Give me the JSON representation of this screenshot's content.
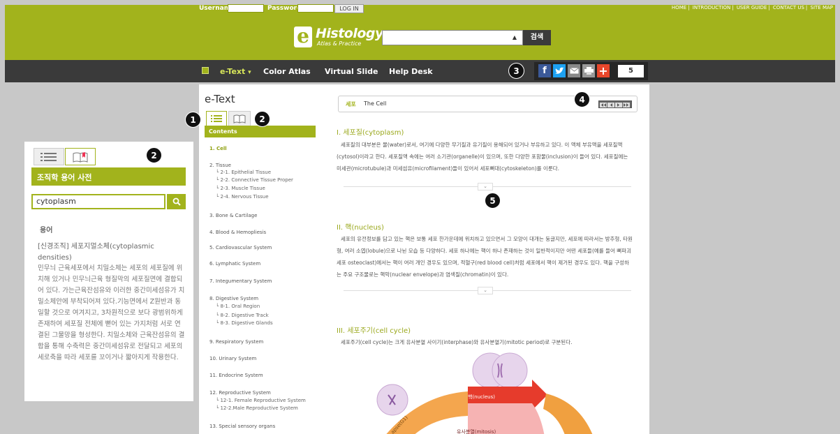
{
  "login": {
    "username_label": "Username",
    "password_label": "Password",
    "login_button": "LOG IN"
  },
  "toplinks": [
    "HOME",
    "INTRODUCTION",
    "USER GUIDE",
    "CONTACT US",
    "SITE MAP"
  ],
  "logo": {
    "mark": "e",
    "title": "Histology",
    "subtitle": "Atlas & Practice"
  },
  "search": {
    "button": "검색",
    "arrow": "▲"
  },
  "nav": {
    "etext": "e-Text",
    "caret": "▾",
    "items": [
      "Color Atlas",
      "Virtual Slide",
      "Help Desk"
    ]
  },
  "social": {
    "share_count": "5",
    "icons": [
      "facebook-icon",
      "twitter-icon",
      "mail-icon",
      "print-icon",
      "plus-icon"
    ]
  },
  "badges": [
    "1",
    "2",
    "2",
    "3",
    "4",
    "5"
  ],
  "dictionary": {
    "header": "조직학 용어 사전",
    "input_value": "cytoplasm",
    "term_heading": "용어",
    "entry_title": "[신경조직] 세포지멀소체(cytoplasmic densities)",
    "entry_text": "민무늬 근육세포에서 치밀소체는 세포의 세포질에 위치해 있거나 민무늬근육 형질막의 세포질면에 결합되어 있다. 가는근육잔섬유와 이러한 중간미세섬유가 치밀소체안에 부착되어져 있다.기능면에서 Z원반과 동일할 것으로 여겨지고, 3차원적으로 보다 광범위하게 존재하여 세포질 전체에 뻗어 있는 가지처럼 서로 연결된 그물망을 형성한다. 치밀소체와 근육잔섬유의 결합을 통해 수축력은 중간미세섬유로 전달되고 세포의 세로축을 따라 세포를 꼬이거나 짧아지게 작용한다."
  },
  "toc": {
    "title": "e-Text",
    "contents_label": "Contents",
    "items": [
      {
        "label": "1. Cell",
        "level": 0,
        "active": true
      },
      {
        "label": "2. Tissue",
        "level": 0
      },
      {
        "label": "└ 2-1. Epithelial Tissue",
        "level": 1
      },
      {
        "label": "└ 2-2. Connective Tissue Proper",
        "level": 1
      },
      {
        "label": "└ 2-3. Muscle Tissue",
        "level": 1
      },
      {
        "label": "└ 2-4. Nervous Tissue",
        "level": 1
      },
      {
        "label": "3. Bone & Cartilage",
        "level": 0
      },
      {
        "label": "4. Blood & Hemopliesis",
        "level": 0
      },
      {
        "label": "5. Cardiovascular System",
        "level": 0
      },
      {
        "label": "6. Lymphatic System",
        "level": 0
      },
      {
        "label": "7. Integumentary System",
        "level": 0
      },
      {
        "label": "8. Digestive System",
        "level": 0
      },
      {
        "label": "└ 8-1. Oral Region",
        "level": 1
      },
      {
        "label": "└ 8-2. Digestive Track",
        "level": 1
      },
      {
        "label": "└ 8-3. Digestive Glands",
        "level": 1
      },
      {
        "label": "9. Respiratory System",
        "level": 0
      },
      {
        "label": "10. Urinary System",
        "level": 0
      },
      {
        "label": "11. Endocrine System",
        "level": 0
      },
      {
        "label": "12. Reproductive System",
        "level": 0
      },
      {
        "label": "└ 12-1. Female Reproductive System",
        "level": 1
      },
      {
        "label": "└ 12-2.Male Reproductive System",
        "level": 1
      },
      {
        "label": "13. Special sensory organs",
        "level": 0
      }
    ]
  },
  "content": {
    "crumb_ko": "세포",
    "crumb_en": "The Cell",
    "sections": [
      {
        "title": "I. 세포질(cytoplasm)",
        "text": "세포질의 대부분은 물(water)로서, 여기에 다양한 무기질과 유기질이 용해되어 있거나 부유하고 있다. 이 액체 부유액을 세포질액(cytosol)이라고 한다. 세포질액 속에는 여러 소기관(organelle)이 있으며, 또한 다양한 포함물(inclusion)이 들어 있다. 세포질에는 미세관(microtubule)과 미세섬유(microfilament)들이 있어서 세포뼈대(cytoskeleton)를 이룬다."
      },
      {
        "title": "II. 핵(nucleus)",
        "text": "세포의 유전정보를 담고 있는 핵은 보통 세포 한가운데에 위치하고 있으면서 그 모양이 대개는 둥글지만, 세포에 따라서는 방추형, 타원형, 여러 소엽(lobule)으로 나뉜 모습 등 다양하다. 세포 하나에는 핵이 하나 존재하는 것이 일반적이지만 어떤 세포들(예를 들어 뼈파괴세포 osteoclast)에서는 핵이 여러 개인 경우도 있으며, 적혈구(red blood cell)처럼 세포에서 핵이 제거된 경우도 있다. 핵을 구성하는 주요 구조물로는 핵막(nuclear envelope)과 염색질(chromatin)이 있다."
      },
      {
        "title": "III. 세포주기(cell cycle)",
        "text": "세포주기(cell cycle)는 크게 유사분열 사이기(interphase)와 유사분열기(mitotic period)로 구분된다."
      }
    ],
    "diagram": {
      "nucleus_label": "핵(nucleus)",
      "mitosis_label": "유사분열(mitosis)",
      "side_label": "apse(G1)"
    }
  }
}
